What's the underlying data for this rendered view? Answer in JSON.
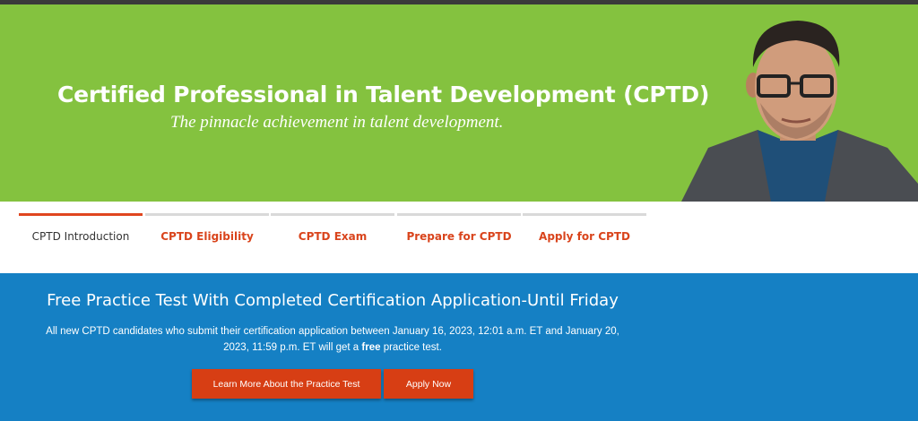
{
  "colors": {
    "hero_green": "#84c23f",
    "tab_active": "#e0461f",
    "tab_text": "#d9441c",
    "promo_blue": "#1580c4",
    "button_red": "#d73e14"
  },
  "hero": {
    "title": "Certified Professional in Talent Development (CPTD)",
    "subtitle": "The pinnacle achievement in talent development."
  },
  "tabs": [
    {
      "label": "CPTD Introduction",
      "active": true
    },
    {
      "label": "CPTD Eligibility",
      "active": false
    },
    {
      "label": "CPTD Exam",
      "active": false
    },
    {
      "label": "Prepare for CPTD",
      "active": false
    },
    {
      "label": "Apply for CPTD",
      "active": false
    }
  ],
  "promo": {
    "title": "Free Practice Test With Completed Certification Application-Until Friday",
    "body_before": "All new CPTD candidates who submit their certification application between January 16, 2023, 12:01 a.m. ET and January 20, 2023, 11:59 p.m. ET will get a ",
    "body_bold": "free",
    "body_after": " practice test.",
    "learn_button": "Learn More About the Practice Test",
    "apply_button": "Apply Now"
  }
}
